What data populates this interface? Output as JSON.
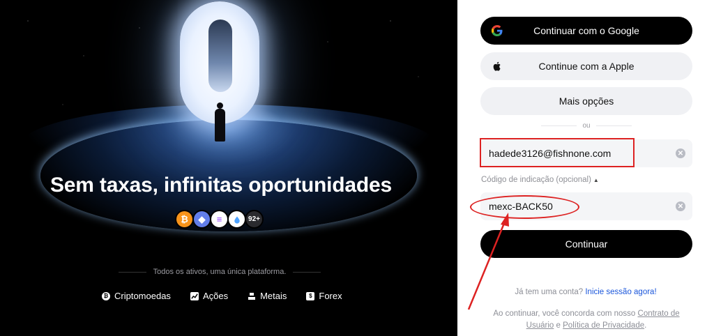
{
  "hero": {
    "title": "Sem taxas, infinitas oportunidades",
    "coins": [
      {
        "name": "btc",
        "glyph": "₿"
      },
      {
        "name": "eth",
        "glyph": "◆"
      },
      {
        "name": "sol",
        "glyph": "≡"
      },
      {
        "name": "sui",
        "glyph": "💧"
      }
    ],
    "more_count": "92+",
    "tagline": "Todos os ativos, uma única plataforma.",
    "assets": [
      {
        "label": "Criptomoedas",
        "icon": "crypto-icon"
      },
      {
        "label": "Ações",
        "icon": "chart-icon"
      },
      {
        "label": "Metais",
        "icon": "metals-icon"
      },
      {
        "label": "Forex",
        "icon": "forex-icon"
      }
    ]
  },
  "auth": {
    "google_label": "Continuar com o Google",
    "apple_label": "Continue com a Apple",
    "more_label": "Mais opções",
    "or_label": "ou",
    "email_value": "hadede3126@fishnone.com",
    "referral_label": "Código de indicação (opcional)",
    "referral_value": "mexc-BACK50",
    "continue_label": "Continuar",
    "have_account": "Já tem uma conta?",
    "login_link": "Inicie sessão agora!",
    "terms_prefix": "Ao continuar, você concorda com nosso",
    "terms_link": "Contrato de Usuário",
    "terms_and": "e",
    "privacy_link": "Política de Privacidade",
    "terms_suffix": "."
  },
  "colors": {
    "accent_link": "#1a56db",
    "annotation": "#d22222",
    "primary_button": "#000000"
  }
}
